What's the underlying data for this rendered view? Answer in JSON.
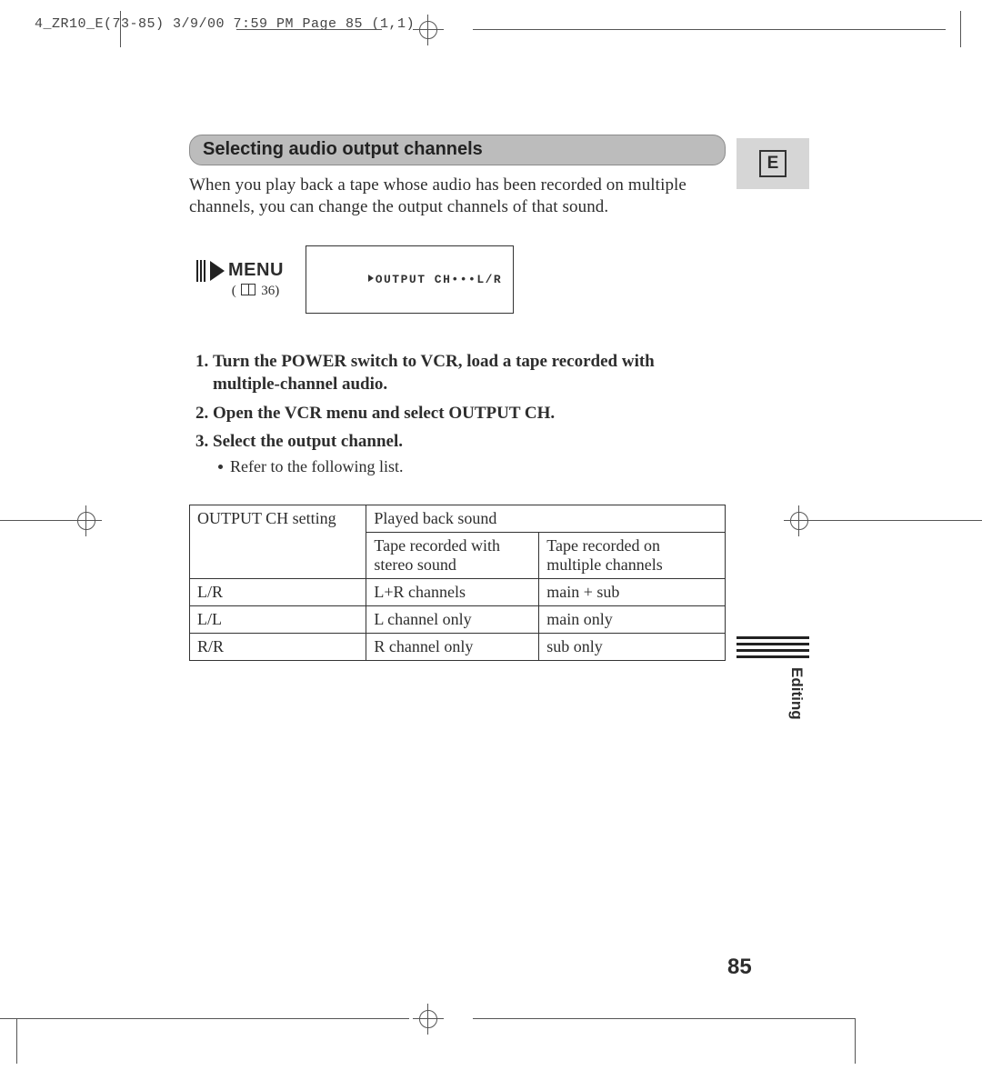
{
  "printHeader": "4_ZR10_E(73-85)  3/9/00 7:59 PM  Page 85 (1,1)",
  "heading": "Selecting audio output channels",
  "intro": "When you play back a tape whose audio has been recorded on multiple channels, you can change the output channels of that sound.",
  "menuLabel": "MENU",
  "menuRefPrefix": "(",
  "menuRefNum": "36)",
  "lcd": "OUTPUT CH•••L/R",
  "steps": [
    {
      "text": "Turn the POWER switch to VCR, load a tape recorded with multiple-channel audio."
    },
    {
      "text": "Open the VCR menu and select OUTPUT CH."
    },
    {
      "text": "Select the output channel.",
      "sub": "Refer to the following list."
    }
  ],
  "table": {
    "headSetting": "OUTPUT CH setting",
    "headPlayed": "Played back sound",
    "headStereo": "Tape recorded with stereo sound",
    "headMulti": "Tape recorded on multiple channels",
    "rows": [
      {
        "setting": "L/R",
        "stereo": "L+R channels",
        "multi": "main + sub"
      },
      {
        "setting": "L/L",
        "stereo": "L channel only",
        "multi": "main only"
      },
      {
        "setting": "R/R",
        "stereo": "R channel only",
        "multi": "sub only"
      }
    ]
  },
  "langBadge": "E",
  "sideTab": "Editing",
  "pageNum": "85"
}
